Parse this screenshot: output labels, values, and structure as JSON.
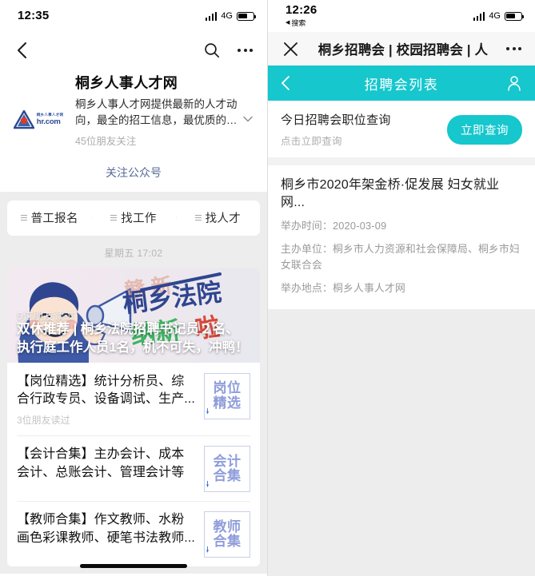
{
  "left": {
    "status": {
      "time": "12:35",
      "network": "4G",
      "signal_icon": "signal-bars-icon",
      "battery_icon": "battery-icon"
    },
    "navbar": {
      "back_icon": "chevron-left-icon",
      "search_icon": "search-icon",
      "more_icon": "more-dots-icon"
    },
    "account": {
      "logo_cn": "桐乡人事人才网",
      "logo_en": "hr.com",
      "title": "桐乡人事人才网",
      "description": "桐乡人事人才网提供最新的人才动向，最全的招工信息，最优质的职业培...",
      "followers": "45位朋友关注",
      "expand_icon": "chevron-down-icon",
      "follow_link": "关注公众号"
    },
    "quickbar": [
      {
        "label": "普工报名",
        "icon": "menu-hamburger-icon"
      },
      {
        "label": "找工作",
        "icon": "menu-hamburger-icon"
      },
      {
        "label": "找人才",
        "icon": "menu-hamburger-icon"
      }
    ],
    "timestamp": "星期五 17:02",
    "feed": {
      "banner": {
        "overlay_text_1": "桐乡法院",
        "overlay_text_2": "纳新啦",
        "read_count": "5位朋友读过",
        "title": "双休推荐 | 桐乡法院招聘书记员２名、执行庭工作人员1名，机不可失，冲鸭！"
      },
      "items": [
        {
          "title": "【岗位精选】统计分析员、综合行政专员、设备调试、生产...",
          "read_count": "3位朋友读过",
          "thumb_line1": "岗位",
          "thumb_line2": "精选"
        },
        {
          "title": "【会计合集】主办会计、成本会计、总账会计、管理会计等",
          "read_count": "",
          "thumb_line1": "会计",
          "thumb_line2": "合集"
        },
        {
          "title": "【教师合集】作文教师、水粉画色彩课教师、硬笔书法教师...",
          "read_count": "",
          "thumb_line1": "教师",
          "thumb_line2": "合集"
        }
      ]
    }
  },
  "right": {
    "status": {
      "time": "12:26",
      "return_label": "搜索",
      "return_icon": "back-triangle-icon",
      "network": "4G",
      "signal_icon": "signal-bars-icon",
      "battery_icon": "battery-icon"
    },
    "navbar": {
      "close_icon": "close-x-icon",
      "title": "桐乡招聘会 | 校园招聘会 | 人",
      "more_icon": "more-dots-icon"
    },
    "teal_header": {
      "back_icon": "chevron-left-icon",
      "title": "招聘会列表",
      "user_icon": "user-profile-icon"
    },
    "query": {
      "main": "今日招聘会职位查询",
      "sub": "点击立即查询",
      "button": "立即查询"
    },
    "event": {
      "title": "桐乡市2020年架金桥·促发展 妇女就业网...",
      "time_label": "举办时间：",
      "time_value": "2020-03-09",
      "org_label": "主办单位：",
      "org_value": "桐乡市人力资源和社会保障局、桐乡市妇女联合会",
      "place_label": "举办地点：",
      "place_value": "桐乡人事人才网"
    }
  },
  "colors": {
    "teal": "#16c7cd",
    "link_blue": "#576b95",
    "thumb_purple": "#8f9ddb",
    "gray_bg": "#ededed"
  }
}
